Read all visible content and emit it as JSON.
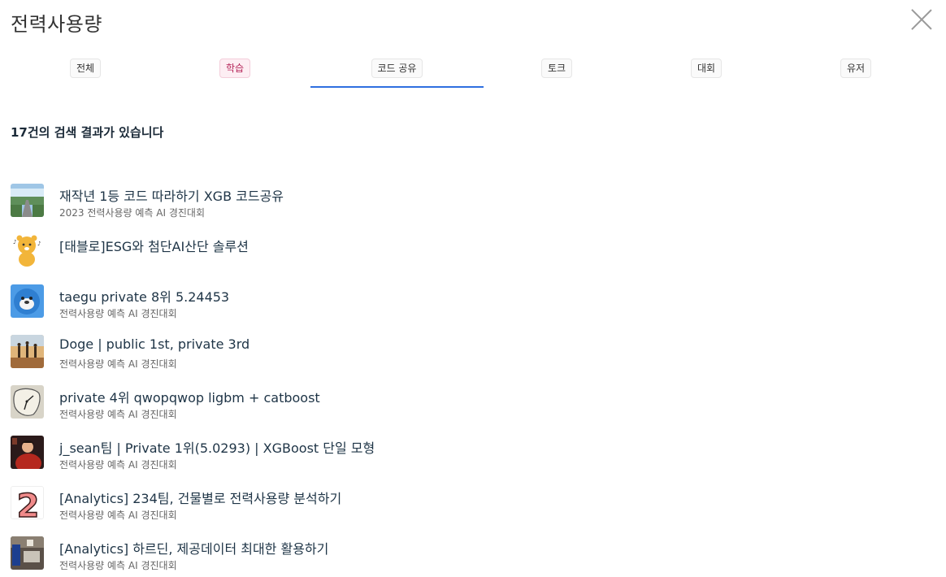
{
  "header": {
    "title": "전력사용량",
    "close_icon": "close-icon"
  },
  "tabs": [
    {
      "label": "전체",
      "active": false
    },
    {
      "label": "학습",
      "active": false,
      "accent": "#b6275b"
    },
    {
      "label": "코드 공유",
      "active": true,
      "accent": "#2f6fe0"
    },
    {
      "label": "토크",
      "active": false
    },
    {
      "label": "대회",
      "active": false
    },
    {
      "label": "유저",
      "active": false
    }
  ],
  "results": {
    "count_text": "17건의 검색 결과가 있습니다",
    "items": [
      {
        "title": "재작년 1등 코드 따라하기 XGB 코드공유",
        "subtitle": "2023 전력사용량 예측 AI 경진대회",
        "thumb": "landscape-road"
      },
      {
        "title": "[태블로]ESG와 첨단AI산단 솔루션",
        "subtitle": "",
        "thumb": "yellow-bear-character"
      },
      {
        "title": "taegu private 8위 5.24453",
        "subtitle": "전력사용량 예측 AI 경진대회",
        "thumb": "blue-bird-character"
      },
      {
        "title": "Doge | public 1st, private 3rd",
        "subtitle": "전력사용량 예측 AI 경진대회",
        "thumb": "desert-riders"
      },
      {
        "title": "private 4위 qwopqwop ligbm + catboost",
        "subtitle": "전력사용량 예측 AI 경진대회",
        "thumb": "melting-clock"
      },
      {
        "title": "j_sean팀 | Private 1위(5.0293) | XGBoost 단일 모형",
        "subtitle": "전력사용량 예측 AI 경진대회",
        "thumb": "person-red-dark"
      },
      {
        "title": "[Analytics] 234팀, 건물별로 전력사용량 분석하기",
        "subtitle": "전력사용량 예측 AI 경진대회",
        "thumb": "number-2"
      },
      {
        "title": "[Analytics] 하르딘, 제공데이터 최대한 활용하기",
        "subtitle": "전력사용량 예측 AI 경진대회",
        "thumb": "room-photo"
      }
    ]
  },
  "thumb_digit": "2"
}
